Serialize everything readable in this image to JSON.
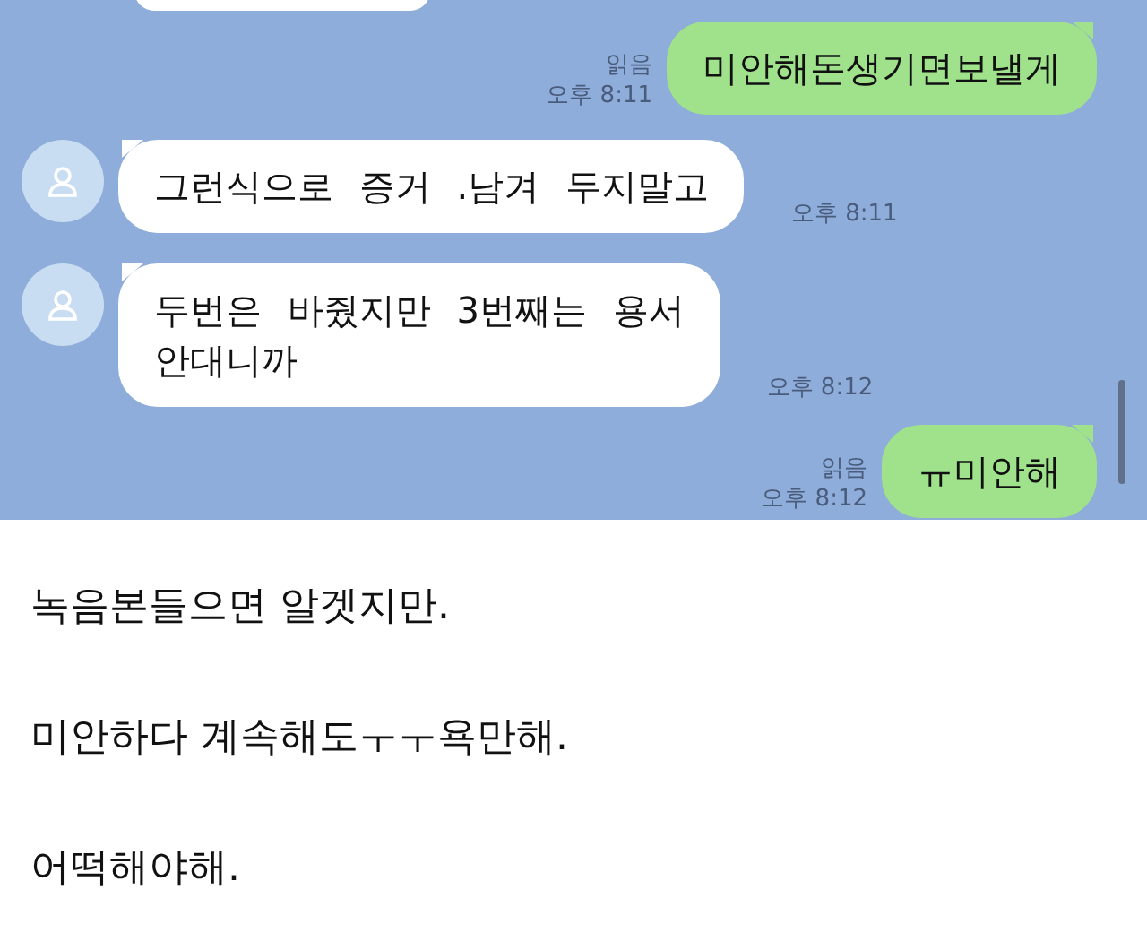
{
  "chat": {
    "messages": [
      {
        "kind": "sent",
        "lines": [
          "미안해돈생기면보낼게"
        ],
        "read": "읽음",
        "time": "오후 8:11"
      },
      {
        "kind": "received",
        "lines": [
          "그런식으로 증거 .남겨 두지말고"
        ],
        "time": "오후 8:11"
      },
      {
        "kind": "received",
        "lines": [
          "두번은 바줬지만 3번째는 용서",
          "안대니까"
        ],
        "time": "오후 8:12"
      },
      {
        "kind": "sent",
        "lines": [
          "ㅠ미안해"
        ],
        "read": "읽음",
        "time": "오후 8:12"
      }
    ]
  },
  "post": {
    "paragraphs": [
      "녹음본들으면 알겟지만.",
      "미안하다 계속해도ㅜㅜ욕만해.",
      "어떡해야해."
    ]
  }
}
